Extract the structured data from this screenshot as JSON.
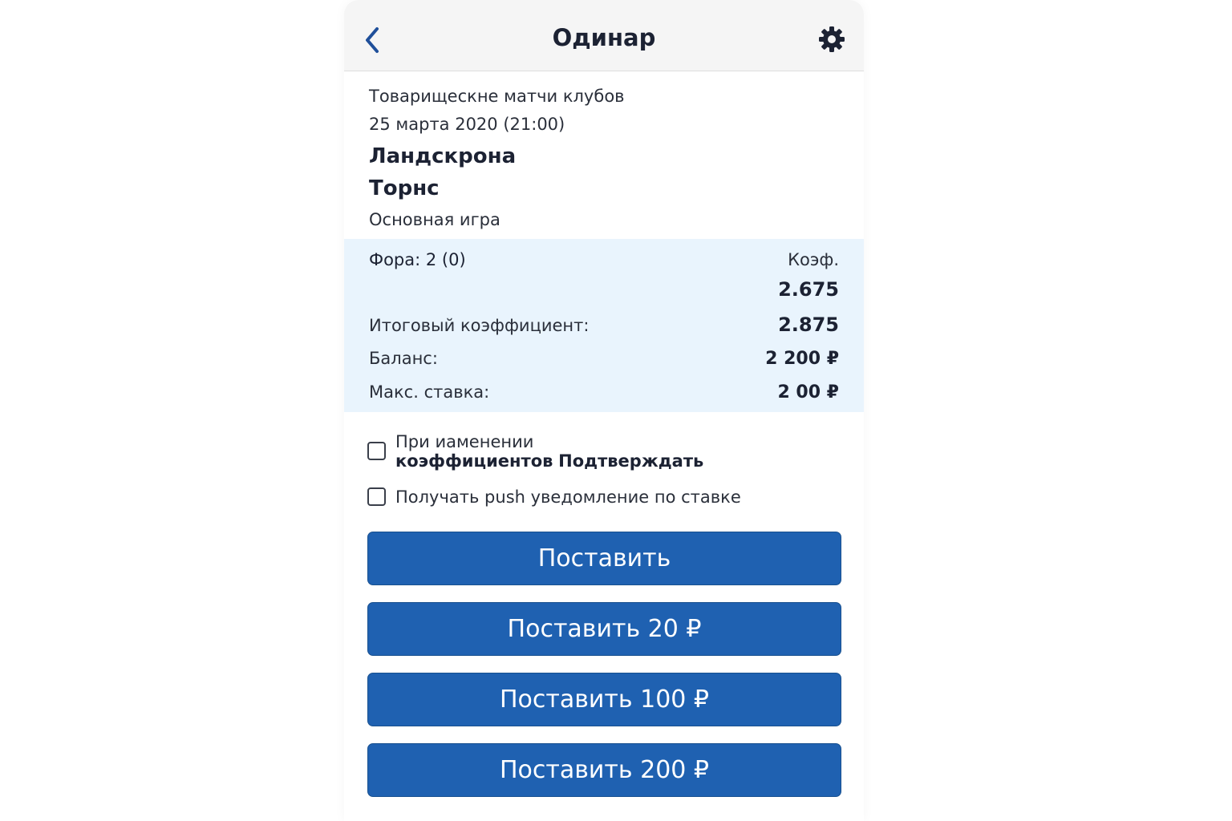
{
  "header": {
    "title": "Одинар",
    "back_icon": "chevron-left-icon",
    "settings_icon": "gear-icon",
    "accent": "#1f61b1"
  },
  "event": {
    "tournament": "Товарищескне матчи клубов",
    "date": "25 марта 2020 (21:00)",
    "team1": "Ландскрона",
    "team2": "Торнс",
    "period": "Основная игра"
  },
  "bet": {
    "outcome": "Фора: 2 (0)",
    "koef_label": "Коэф.",
    "koef_value": "2.675",
    "total_label": "Итоговый коэффициент:",
    "total_value": "2.875",
    "balance_label": "Баланс:",
    "balance_value": "2 200 ₽",
    "max_label": "Макс. ставка:",
    "max_value": "2 00 ₽",
    "panel_color": "#e9f4fd"
  },
  "options": {
    "confirm_prefix": "При иаменении ",
    "confirm_bold1": "коэффициентов",
    "confirm_bold2": "Подтверждать",
    "push": "Получать push уведомление по ставке"
  },
  "buttons": {
    "place": "Поставить",
    "place20": "Поставить 20 ₽",
    "place100": "Поставить 100 ₽",
    "place200": "Поставить 200 ₽",
    "color": "#1f61b1"
  }
}
